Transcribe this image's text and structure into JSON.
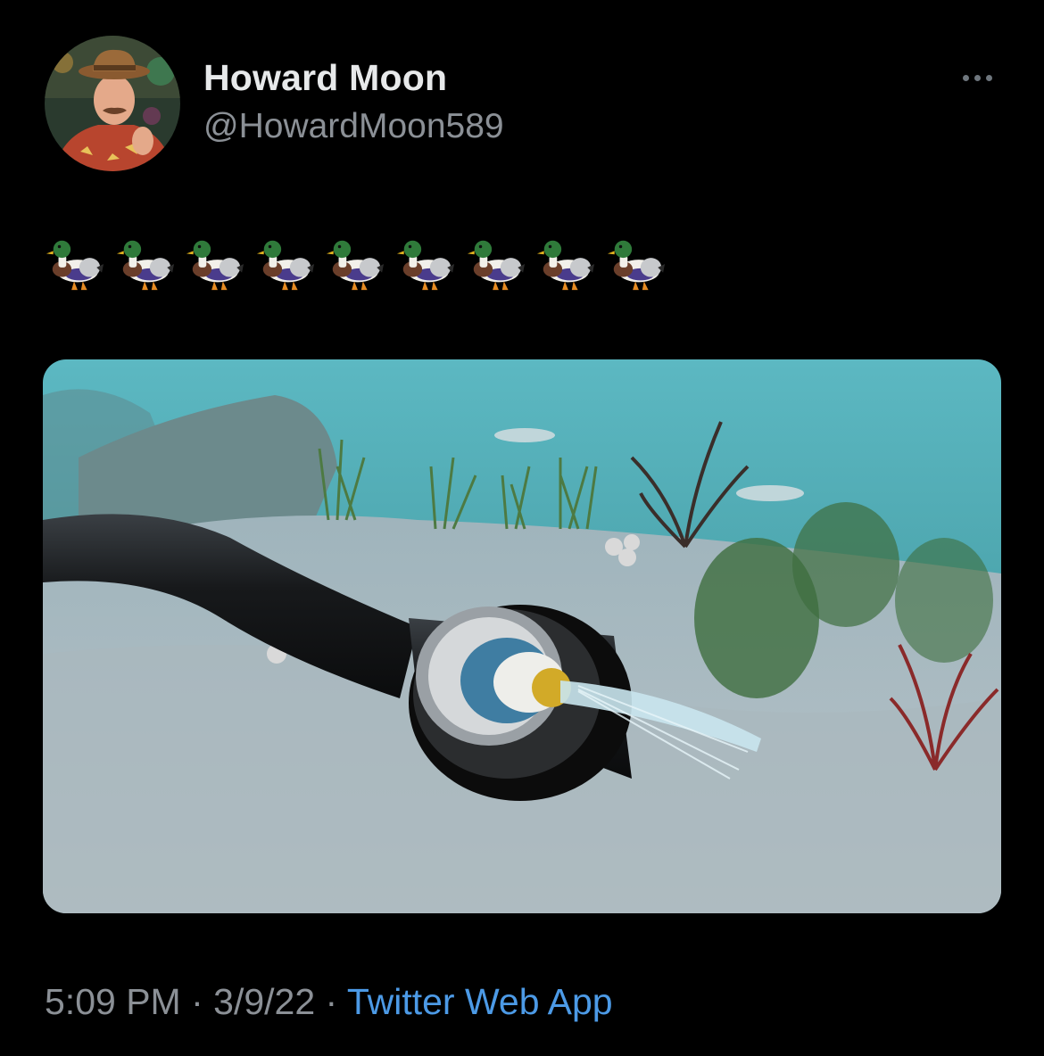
{
  "author": {
    "display_name": "Howard Moon",
    "handle": "@HowardMoon589"
  },
  "tweet": {
    "text": "🦆🦆🦆🦆🦆🦆🦆🦆🦆",
    "emoji_count": 9,
    "emoji_icon": "mallard-duck-emoji"
  },
  "meta": {
    "time": "5:09 PM",
    "separator_1": " · ",
    "date": "3/9/22",
    "separator_2": " · ",
    "source": "Twitter Web App"
  },
  "colors": {
    "background": "#000000",
    "name": "#e7e9ea",
    "secondary": "#8b9096",
    "link": "#4c9ae6"
  },
  "icons": {
    "more": "more-horizontal-icon"
  }
}
